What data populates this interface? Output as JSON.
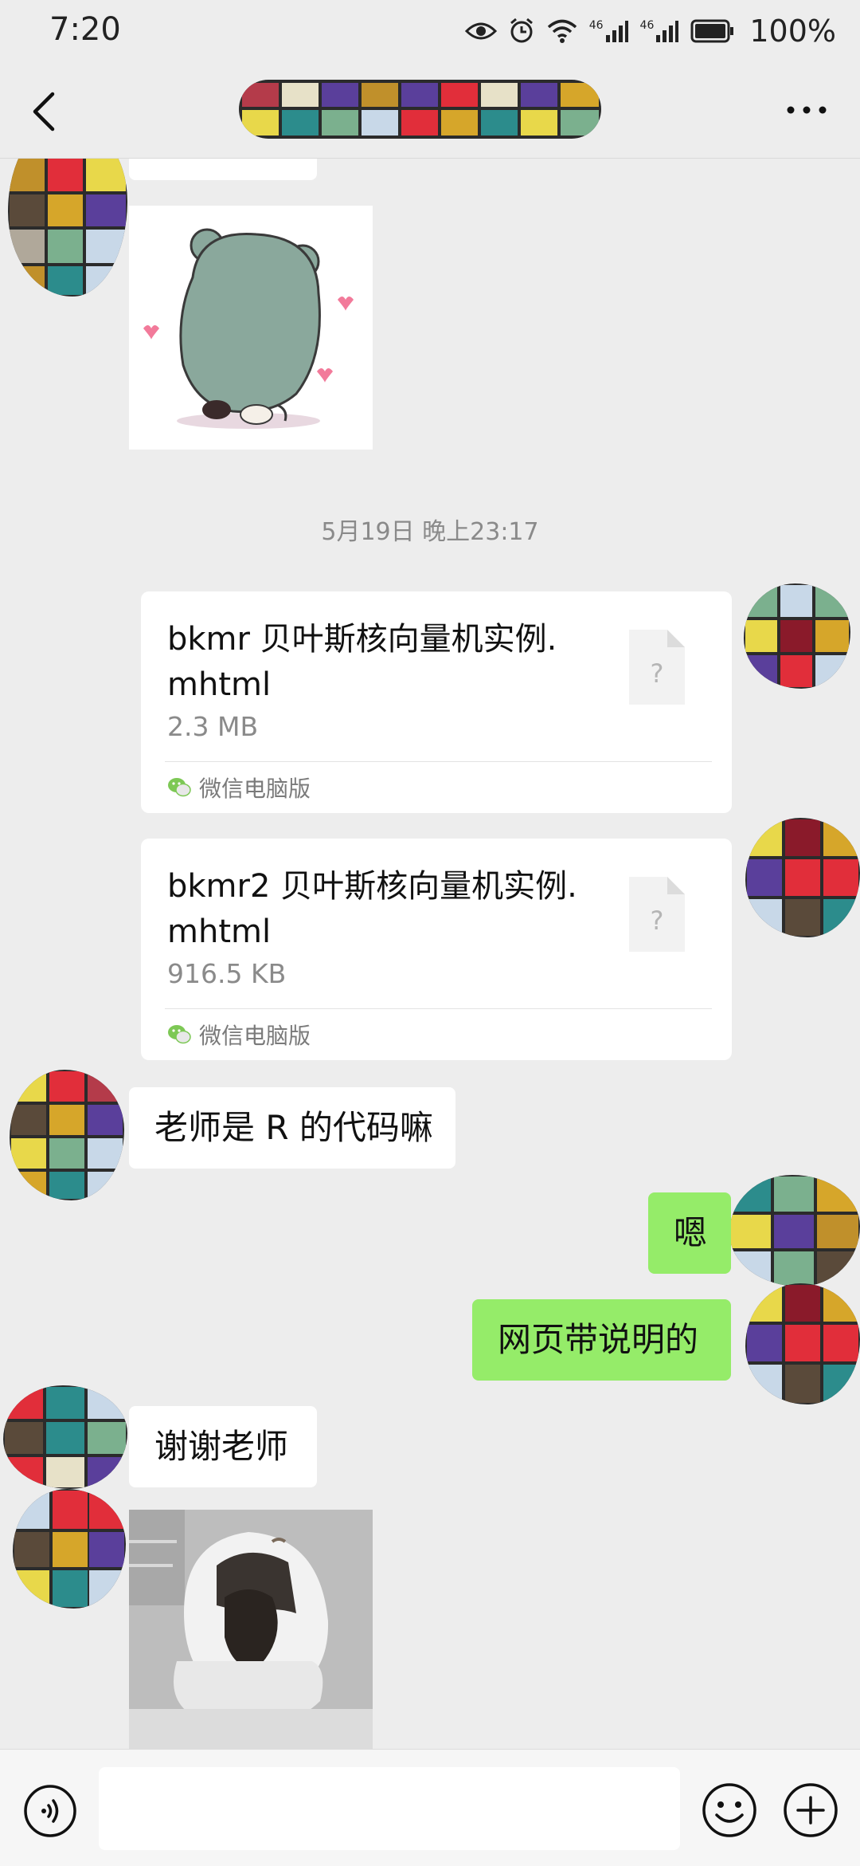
{
  "status_bar": {
    "time": "7:20",
    "signal1": "46",
    "signal2": "46",
    "battery": "100%"
  },
  "header": {
    "title_hidden": true,
    "more_label": "···"
  },
  "colors": {
    "self_bubble": "#95ec69",
    "other_bubble": "#ffffff",
    "background": "#ededed"
  },
  "messages": {
    "timestamp": "5月19日 晚上23:17",
    "file1": {
      "name": "bkmr 贝叶斯核向量机实例.mhtml",
      "size": "2.3 MB",
      "source": "微信电脑版"
    },
    "file2": {
      "name": "bkmr2 贝叶斯核向量机实例.mhtml",
      "size": "916.5 KB",
      "source": "微信电脑版"
    },
    "msg1": "老师是 R 的代码嘛",
    "msg2": "嗯",
    "msg3": "网页带说明的",
    "msg4": "谢谢老师"
  },
  "input": {
    "placeholder": ""
  }
}
